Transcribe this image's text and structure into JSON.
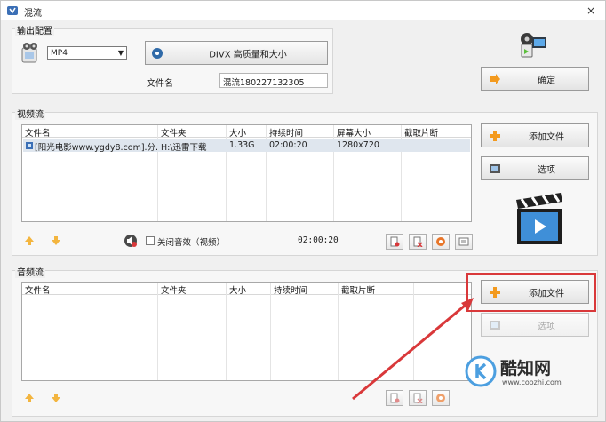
{
  "window": {
    "title": "混流",
    "close_glyph": "×"
  },
  "output_config": {
    "group_title": "输出配置",
    "format_value": "MP4",
    "codec_label": "DIVX 高质量和大小",
    "filename_label": "文件名",
    "filename_value": "混流180227132305",
    "confirm_label": "确定"
  },
  "video_stream": {
    "group_title": "视频流",
    "columns": [
      "文件名",
      "文件夹",
      "大小",
      "持续时间",
      "屏幕大小",
      "截取片断"
    ],
    "rows": [
      {
        "name": "[阳光电影www.ygdy8.com].分...",
        "folder": "H:\\迅雷下载",
        "size": "1.33G",
        "duration": "02:00:20",
        "screen": "1280x720",
        "clip": ""
      }
    ],
    "mute_label": "关闭音效（视频）",
    "total_duration": "02:00:20",
    "add_file_label": "添加文件",
    "options_label": "选项"
  },
  "audio_stream": {
    "group_title": "音频流",
    "columns": [
      "文件名",
      "文件夹",
      "大小",
      "持续时间",
      "截取片断"
    ],
    "add_file_label": "添加文件",
    "options_label": "选项"
  },
  "watermark": {
    "brand": "酷知网",
    "url": "www.coozhi.com"
  },
  "colors": {
    "accent_orange": "#f39a1e",
    "highlight_red": "#d9383a",
    "selected_row": "#dfe6ee"
  }
}
